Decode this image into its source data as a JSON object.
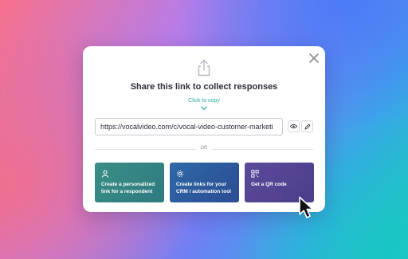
{
  "modal": {
    "title": "Share this link to collect responses",
    "copy_label": "Click to copy",
    "url": "https://vocalvideo.com/c/vocal-video-customer-marketi",
    "divider_label": "OR",
    "cards": [
      {
        "label_line1": "Create a personalized",
        "label_line2": "link for a respondent",
        "icon": "person-icon",
        "color": "#3a8f86"
      },
      {
        "label_line1": "Create links for your",
        "label_line2": "CRM / automation tool",
        "icon": "gear-icon",
        "color": "#2f68a6"
      },
      {
        "label_line1": "Get a QR code",
        "label_line2": "",
        "icon": "qr-code-icon",
        "color": "#5b4a9a"
      }
    ]
  },
  "colors": {
    "accent": "#2fa9a0",
    "text": "#2e2e3a"
  }
}
